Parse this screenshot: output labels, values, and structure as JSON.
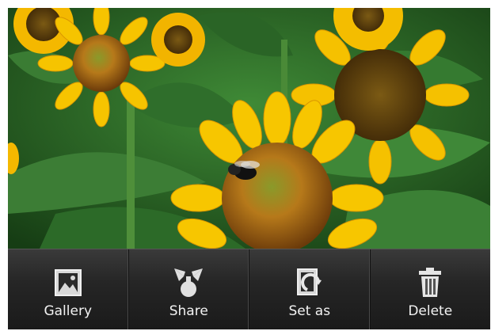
{
  "photo": {
    "subject": "sunflowers-with-bee"
  },
  "action_bar": {
    "items": [
      {
        "label": "Gallery",
        "icon": "gallery-icon"
      },
      {
        "label": "Share",
        "icon": "share-icon"
      },
      {
        "label": "Set as",
        "icon": "set-as-icon"
      },
      {
        "label": "Delete",
        "icon": "trash-icon"
      }
    ]
  },
  "colors": {
    "petal": "#f4b800",
    "leaf": "#2f6e2b",
    "bar": "#262626",
    "label": "#f2f2f2"
  }
}
